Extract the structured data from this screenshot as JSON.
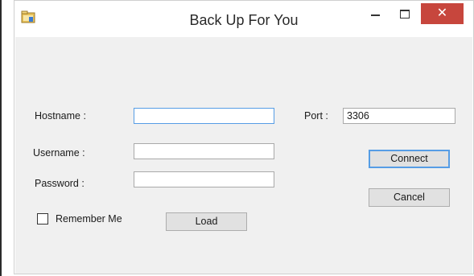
{
  "window": {
    "title": "Back Up For You",
    "close_glyph": "✕"
  },
  "form": {
    "hostname_label": "Hostname :",
    "hostname_value": "",
    "username_label": "Username :",
    "username_value": "",
    "password_label": "Password :",
    "password_value": "",
    "port_label": "Port :",
    "port_value": "3306",
    "remember_label": "Remember Me",
    "remember_checked": false
  },
  "buttons": {
    "connect": "Connect",
    "cancel": "Cancel",
    "load": "Load"
  },
  "icons": {
    "app": "app-folder-icon",
    "minimize": "minimize-icon",
    "maximize": "maximize-icon",
    "close": "close-icon"
  },
  "colors": {
    "close_button": "#c7463d",
    "focus_border": "#569de5",
    "client_background": "#f0f0f0"
  }
}
